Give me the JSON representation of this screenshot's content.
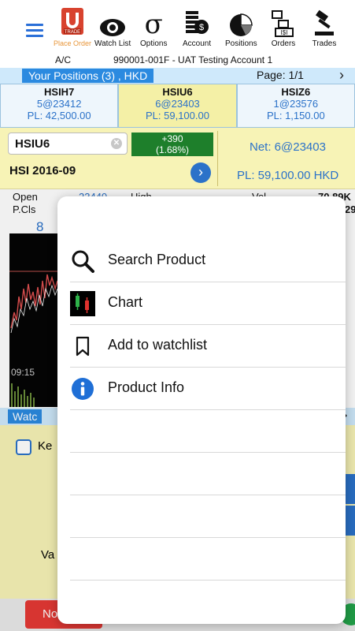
{
  "toolbar": {
    "items": [
      {
        "icon": "place-order-icon",
        "label": "Place Order",
        "sub": "TRADE"
      },
      {
        "icon": "eye-icon",
        "label": "Watch List"
      },
      {
        "icon": "sigma-icon",
        "label": "Options"
      },
      {
        "icon": "coins-icon",
        "label": "Account"
      },
      {
        "icon": "pie-chart-icon",
        "label": "Positions"
      },
      {
        "icon": "orders-icon",
        "label": "Orders"
      },
      {
        "icon": "gavel-icon",
        "label": "Trades"
      }
    ],
    "account_label": "A/C",
    "account_value": "990001-001F - UAT Testing Account 1"
  },
  "positions": {
    "title": "Your Positions (3) , HKD",
    "page": "Page: 1/1",
    "cards": [
      {
        "sym": "HSIH7",
        "qty": "5@23412",
        "pl": "PL: 42,500.00"
      },
      {
        "sym": "HSIU6",
        "qty": "6@23403",
        "pl": "PL: 59,100.00"
      },
      {
        "sym": "HSIZ6",
        "qty": "1@23576",
        "pl": "PL: 1,150.00"
      }
    ]
  },
  "quote": {
    "symbol": "HSIU6",
    "change": "+390",
    "change_pct": "(1.68%)",
    "net": "Net: 6@23403",
    "name": "HSI 2016-09",
    "pl": "PL: 59,100.00 HKD"
  },
  "market": {
    "open_label": "Open",
    "open_value": "23440",
    "pcls_label": "P.Cls",
    "high_label": "High",
    "vol_label": "Vol",
    "vol_value": "70.89K",
    "vol_sub": "29",
    "row_num": "8",
    "time": "09:15"
  },
  "watch": {
    "tab": "Watc"
  },
  "lower": {
    "keep_label": "Ke",
    "va_label": "Va"
  },
  "bottom": {
    "btn": "No"
  },
  "menu": {
    "items": [
      {
        "icon": "search-icon",
        "label": "Search Product"
      },
      {
        "icon": "chart-icon",
        "label": "Chart"
      },
      {
        "icon": "bookmark-icon",
        "label": "Add to watchlist"
      },
      {
        "icon": "info-icon",
        "label": "Product Info"
      }
    ]
  },
  "colors": {
    "accent": "#2b72c9",
    "highlight": "#f4f0a6",
    "up": "#1e7f2b",
    "sell": "#e53935"
  }
}
